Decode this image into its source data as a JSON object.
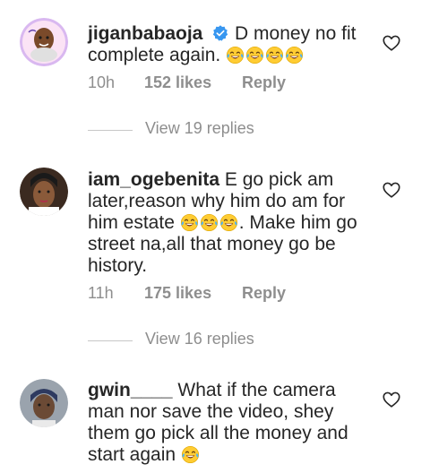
{
  "comments": [
    {
      "username": "jiganbabaoja",
      "verified": true,
      "text_before": "D money no fit complete again.",
      "emojis": [
        "tears-of-joy",
        "tears-of-joy",
        "tears-of-joy",
        "tears-of-joy"
      ],
      "text_after": "",
      "time": "10h",
      "likes": "152 likes",
      "reply": "Reply",
      "view_replies": "View 19 replies"
    },
    {
      "username": "iam_ogebenita",
      "verified": false,
      "text_before": "E go pick am later,reason why him do am for him estate",
      "emojis": [
        "tears-of-joy",
        "tears-of-joy",
        "tears-of-joy"
      ],
      "text_after": ". Make him go street na,all that money go be history.",
      "time": "11h",
      "likes": "175 likes",
      "reply": "Reply",
      "view_replies": "View 16 replies"
    },
    {
      "username": "gwin____",
      "verified": false,
      "text_before": "What if the camera man nor save the video, shey them go pick all the money and start again",
      "emojis": [
        "tears-of-joy"
      ],
      "text_after": ""
    }
  ],
  "colors": {
    "text": "#262626",
    "muted": "#8e8e8e",
    "verified": "#3897f0",
    "divider": "#c7c7c7"
  }
}
